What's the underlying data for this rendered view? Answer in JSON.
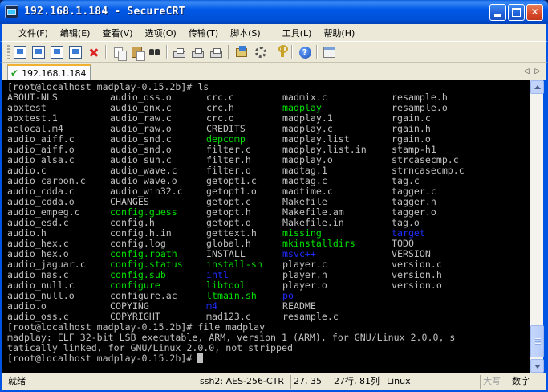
{
  "window": {
    "title": "192.168.1.184 - SecureCRT"
  },
  "menu": [
    "文件(F)",
    "编辑(E)",
    "查看(V)",
    "选项(O)",
    "传输(T)",
    "脚本(S)",
    "工具(L)",
    "帮助(H)"
  ],
  "toolbar": {
    "icons": [
      "connect-icon",
      "quick-connect-icon",
      "connect-in-tab-icon",
      "reconnect-icon",
      "disconnect-icon",
      "copy-icon",
      "paste-icon",
      "find-icon",
      "print-setup-icon",
      "print-icon",
      "print-screen-icon",
      "session-options-icon",
      "global-options-icon",
      "keymap-icon",
      "help-icon",
      "window-icon"
    ]
  },
  "tab": {
    "label": "192.168.1.184"
  },
  "terminal": {
    "prompt_ls": "[root@localhost madplay-0.15.2b]# ls",
    "ls_rows": [
      [
        {
          "t": "ABOUT-NLS",
          "k": ""
        },
        {
          "t": "audio_oss.o",
          "k": ""
        },
        {
          "t": "crc.c",
          "k": ""
        },
        {
          "t": "madmix.c",
          "k": ""
        },
        {
          "t": "resample.h",
          "k": ""
        }
      ],
      [
        {
          "t": "abxtest",
          "k": ""
        },
        {
          "t": "audio_qnx.c",
          "k": ""
        },
        {
          "t": "crc.h",
          "k": ""
        },
        {
          "t": "madplay",
          "k": "exec"
        },
        {
          "t": "resample.o",
          "k": ""
        }
      ],
      [
        {
          "t": "abxtest.1",
          "k": ""
        },
        {
          "t": "audio_raw.c",
          "k": ""
        },
        {
          "t": "crc.o",
          "k": ""
        },
        {
          "t": "madplay.1",
          "k": ""
        },
        {
          "t": "rgain.c",
          "k": ""
        }
      ],
      [
        {
          "t": "aclocal.m4",
          "k": ""
        },
        {
          "t": "audio_raw.o",
          "k": ""
        },
        {
          "t": "CREDITS",
          "k": ""
        },
        {
          "t": "madplay.c",
          "k": ""
        },
        {
          "t": "rgain.h",
          "k": ""
        }
      ],
      [
        {
          "t": "audio_aiff.c",
          "k": ""
        },
        {
          "t": "audio_snd.c",
          "k": ""
        },
        {
          "t": "depcomp",
          "k": "exec"
        },
        {
          "t": "madplay.list",
          "k": ""
        },
        {
          "t": "rgain.o",
          "k": ""
        }
      ],
      [
        {
          "t": "audio_aiff.o",
          "k": ""
        },
        {
          "t": "audio_snd.o",
          "k": ""
        },
        {
          "t": "filter.c",
          "k": ""
        },
        {
          "t": "madplay.list.in",
          "k": ""
        },
        {
          "t": "stamp-h1",
          "k": ""
        }
      ],
      [
        {
          "t": "audio_alsa.c",
          "k": ""
        },
        {
          "t": "audio_sun.c",
          "k": ""
        },
        {
          "t": "filter.h",
          "k": ""
        },
        {
          "t": "madplay.o",
          "k": ""
        },
        {
          "t": "strcasecmp.c",
          "k": ""
        }
      ],
      [
        {
          "t": "audio.c",
          "k": ""
        },
        {
          "t": "audio_wave.c",
          "k": ""
        },
        {
          "t": "filter.o",
          "k": ""
        },
        {
          "t": "madtag.1",
          "k": ""
        },
        {
          "t": "strncasecmp.c",
          "k": ""
        }
      ],
      [
        {
          "t": "audio_carbon.c",
          "k": ""
        },
        {
          "t": "audio_wave.o",
          "k": ""
        },
        {
          "t": "getopt1.c",
          "k": ""
        },
        {
          "t": "madtag.c",
          "k": ""
        },
        {
          "t": "tag.c",
          "k": ""
        }
      ],
      [
        {
          "t": "audio_cdda.c",
          "k": ""
        },
        {
          "t": "audio_win32.c",
          "k": ""
        },
        {
          "t": "getopt1.o",
          "k": ""
        },
        {
          "t": "madtime.c",
          "k": ""
        },
        {
          "t": "tagger.c",
          "k": ""
        }
      ],
      [
        {
          "t": "audio_cdda.o",
          "k": ""
        },
        {
          "t": "CHANGES",
          "k": ""
        },
        {
          "t": "getopt.c",
          "k": ""
        },
        {
          "t": "Makefile",
          "k": ""
        },
        {
          "t": "tagger.h",
          "k": ""
        }
      ],
      [
        {
          "t": "audio_empeg.c",
          "k": ""
        },
        {
          "t": "config.guess",
          "k": "exec"
        },
        {
          "t": "getopt.h",
          "k": ""
        },
        {
          "t": "Makefile.am",
          "k": ""
        },
        {
          "t": "tagger.o",
          "k": ""
        }
      ],
      [
        {
          "t": "audio_esd.c",
          "k": ""
        },
        {
          "t": "config.h",
          "k": ""
        },
        {
          "t": "getopt.o",
          "k": ""
        },
        {
          "t": "Makefile.in",
          "k": ""
        },
        {
          "t": "tag.o",
          "k": ""
        }
      ],
      [
        {
          "t": "audio.h",
          "k": ""
        },
        {
          "t": "config.h.in",
          "k": ""
        },
        {
          "t": "gettext.h",
          "k": ""
        },
        {
          "t": "missing",
          "k": "exec"
        },
        {
          "t": "target",
          "k": "dir"
        }
      ],
      [
        {
          "t": "audio_hex.c",
          "k": ""
        },
        {
          "t": "config.log",
          "k": ""
        },
        {
          "t": "global.h",
          "k": ""
        },
        {
          "t": "mkinstalldirs",
          "k": "exec"
        },
        {
          "t": "TODO",
          "k": ""
        }
      ],
      [
        {
          "t": "audio_hex.o",
          "k": ""
        },
        {
          "t": "config.rpath",
          "k": "exec"
        },
        {
          "t": "INSTALL",
          "k": ""
        },
        {
          "t": "msvc++",
          "k": "dir"
        },
        {
          "t": "VERSION",
          "k": ""
        }
      ],
      [
        {
          "t": "audio_jaguar.c",
          "k": ""
        },
        {
          "t": "config.status",
          "k": "exec"
        },
        {
          "t": "install-sh",
          "k": "exec"
        },
        {
          "t": "player.c",
          "k": ""
        },
        {
          "t": "version.c",
          "k": ""
        }
      ],
      [
        {
          "t": "audio_nas.c",
          "k": ""
        },
        {
          "t": "config.sub",
          "k": "exec"
        },
        {
          "t": "intl",
          "k": "dir"
        },
        {
          "t": "player.h",
          "k": ""
        },
        {
          "t": "version.h",
          "k": ""
        }
      ],
      [
        {
          "t": "audio_null.c",
          "k": ""
        },
        {
          "t": "configure",
          "k": "exec"
        },
        {
          "t": "libtool",
          "k": "exec"
        },
        {
          "t": "player.o",
          "k": ""
        },
        {
          "t": "version.o",
          "k": ""
        }
      ],
      [
        {
          "t": "audio_null.o",
          "k": ""
        },
        {
          "t": "configure.ac",
          "k": ""
        },
        {
          "t": "ltmain.sh",
          "k": "exec"
        },
        {
          "t": "po",
          "k": "dir"
        },
        {
          "t": "",
          "k": ""
        }
      ],
      [
        {
          "t": "audio.o",
          "k": ""
        },
        {
          "t": "COPYING",
          "k": ""
        },
        {
          "t": "m4",
          "k": "dir"
        },
        {
          "t": "README",
          "k": ""
        },
        {
          "t": "",
          "k": ""
        }
      ],
      [
        {
          "t": "audio_oss.c",
          "k": ""
        },
        {
          "t": "COPYRIGHT",
          "k": ""
        },
        {
          "t": "mad123.c",
          "k": ""
        },
        {
          "t": "resample.c",
          "k": ""
        },
        {
          "t": "",
          "k": ""
        }
      ]
    ],
    "prompt_file": "[root@localhost madplay-0.15.2b]# file madplay",
    "file_output_1": "madplay: ELF 32-bit LSB executable, ARM, version 1 (ARM), for GNU/Linux 2.0.0, s",
    "file_output_2": "tatically linked, for GNU/Linux 2.0.0, not stripped",
    "prompt_final": "[root@localhost madplay-0.15.2b]# "
  },
  "status": {
    "ready": "就绪",
    "cipher": "ssh2: AES-256-CTR",
    "cursor": "27, 35",
    "rows_cols": "27行, 81列",
    "term": "Linux",
    "caps": "大写",
    "num": "数字"
  },
  "colors": {
    "executable": "#00e000",
    "directory": "#1e2cff",
    "terminal_bg": "#000000",
    "terminal_fg": "#c0c0c0",
    "titlebar": "#0054e3"
  }
}
